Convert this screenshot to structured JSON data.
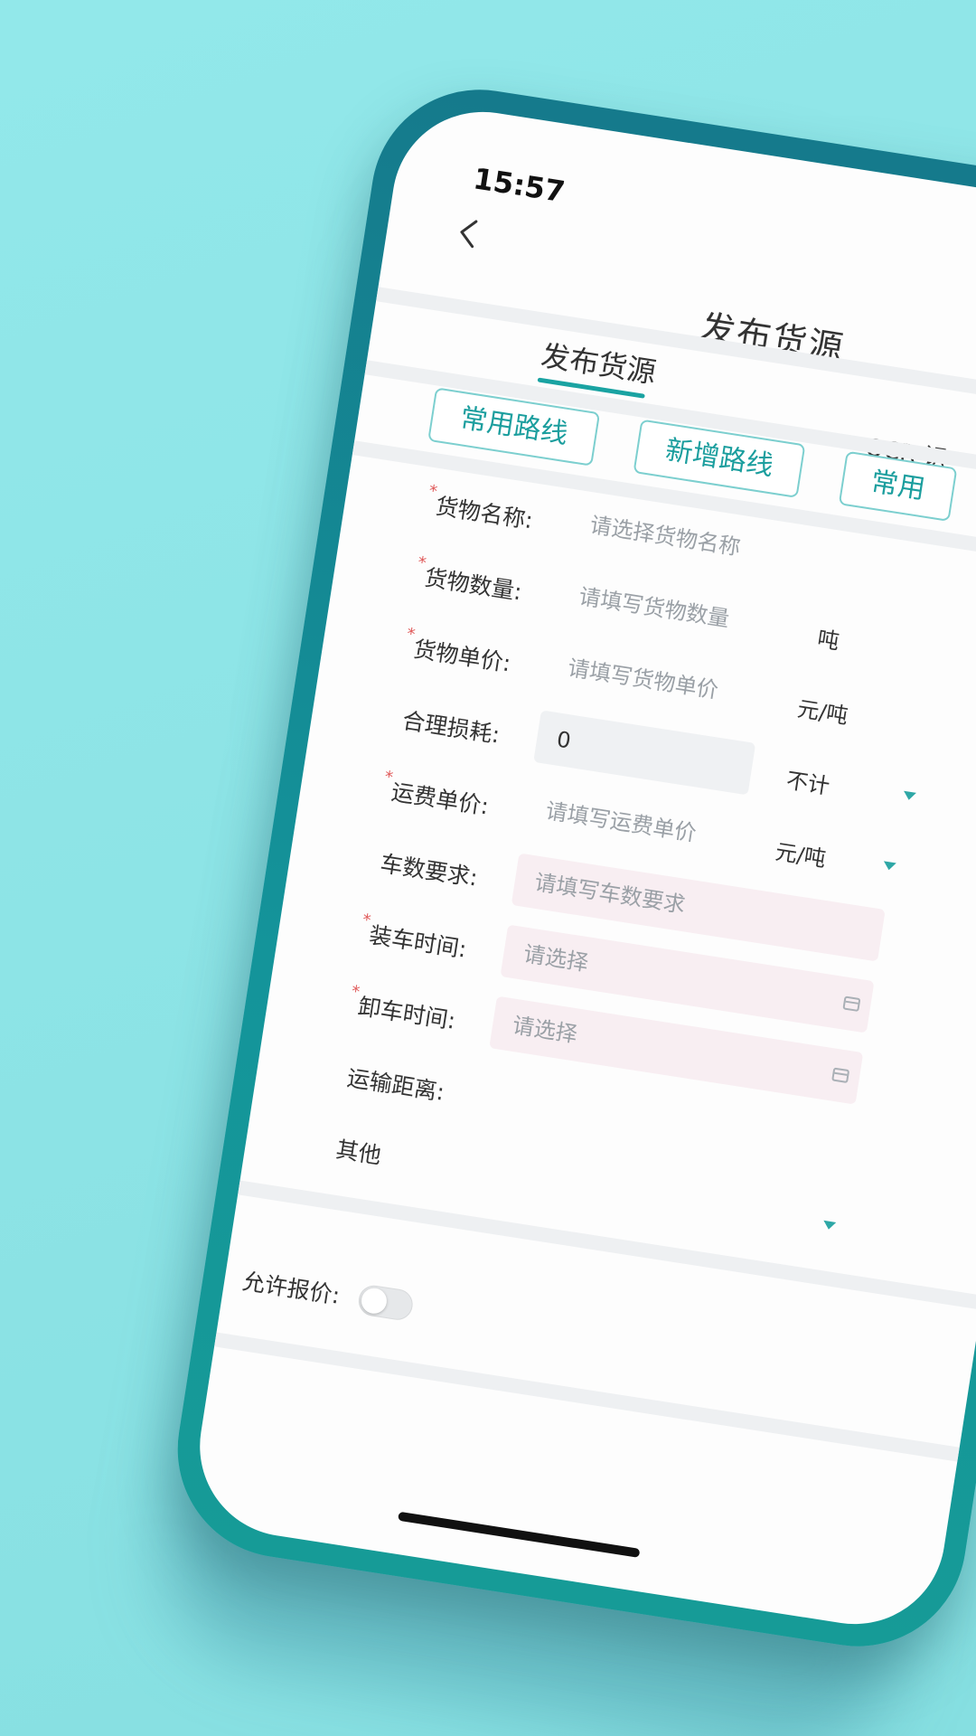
{
  "status_bar": {
    "time": "15:57"
  },
  "header": {
    "title": "发布货源"
  },
  "tabs": [
    {
      "label": "发布货源",
      "active": true
    }
  ],
  "ocr_label": "OCR 识",
  "route_buttons": [
    {
      "label": "常用路线"
    },
    {
      "label": "新增路线"
    },
    {
      "label": "常用"
    }
  ],
  "form": {
    "cargo_name": {
      "label": "货物名称:",
      "required": true,
      "placeholder": "请选择货物名称"
    },
    "cargo_quantity": {
      "label": "货物数量:",
      "required": true,
      "placeholder": "请填写货物数量",
      "unit": "吨"
    },
    "cargo_unit_price": {
      "label": "货物单价:",
      "required": true,
      "placeholder": "请填写货物单价",
      "unit": "元/吨"
    },
    "reasonable_loss": {
      "label": "合理损耗:",
      "required": false,
      "value": "0",
      "unit": "不计"
    },
    "freight_unit_price": {
      "label": "运费单价:",
      "required": true,
      "placeholder": "请填写运费单价",
      "unit": "元/吨"
    },
    "vehicle_count": {
      "label": "车数要求:",
      "required": false,
      "placeholder": "请填写车数要求"
    },
    "loading_time": {
      "label": "装车时间:",
      "required": true,
      "placeholder": "请选择"
    },
    "unloading_time": {
      "label": "卸车时间:",
      "required": true,
      "placeholder": "请选择"
    },
    "transport_distance": {
      "label": "运输距离:"
    },
    "other": {
      "label": "其他"
    },
    "allow_quote": {
      "label": "允许报价:",
      "enabled": false
    }
  },
  "colors": {
    "accent": "#1aa3a2",
    "background": "#8fe6e7",
    "phone_frame": "#157a8c",
    "required_mark": "#e05a5a",
    "pink_input": "#f8eef2"
  }
}
